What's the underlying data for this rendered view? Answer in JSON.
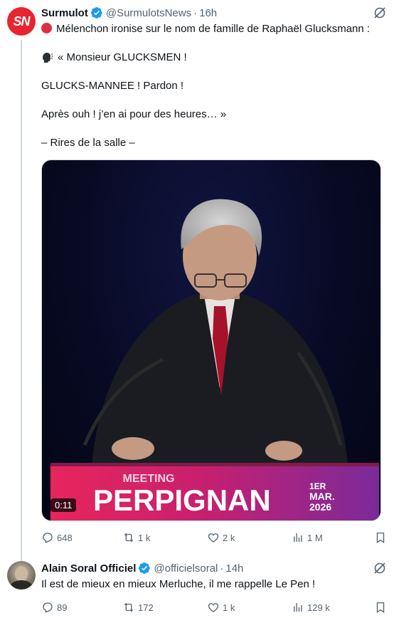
{
  "post1": {
    "author_name": "Surmulot",
    "author_handle": "@SurmulotsNews",
    "separator": "·",
    "time": "16h",
    "avatar_text": "SN",
    "lines": [
      "Mélenchon ironise sur le nom de famille de Raphaël Glucksmann :",
      "« Monsieur GLUCKSMEN !",
      "GLUCKS-MANNEE ! Pardon !",
      "Après ouh ! j’en ai pour des heures… »",
      "– Rires de la salle –"
    ],
    "video": {
      "duration": "0:11",
      "banner_top": "MEETING",
      "banner_main": "PERPIGNAN",
      "banner_date_1": "1ER",
      "banner_date_2": "MAR.",
      "banner_date_3": "2026"
    },
    "stats": {
      "replies": "648",
      "reposts": "1 k",
      "likes": "2 k",
      "views": "1 M"
    }
  },
  "post2": {
    "author_name": "Alain Soral Officiel",
    "author_handle": "@officielsoral",
    "separator": "·",
    "time": "14h",
    "text": "Il est de mieux en mieux Merluche, il me rappelle Le Pen !",
    "stats": {
      "replies": "89",
      "reposts": "172",
      "likes": "1 k",
      "views": "129 k"
    }
  },
  "colors": {
    "accent": "#1d9bf0",
    "muted": "#536471",
    "brand_sn": "#e8242e",
    "thread_line": "#cfd9de"
  },
  "icons": [
    "verified-badge-icon",
    "grok-icon",
    "reply-icon",
    "repost-icon",
    "like-icon",
    "views-icon",
    "bookmark-icon",
    "red-circle-icon",
    "speaking-head-icon"
  ]
}
